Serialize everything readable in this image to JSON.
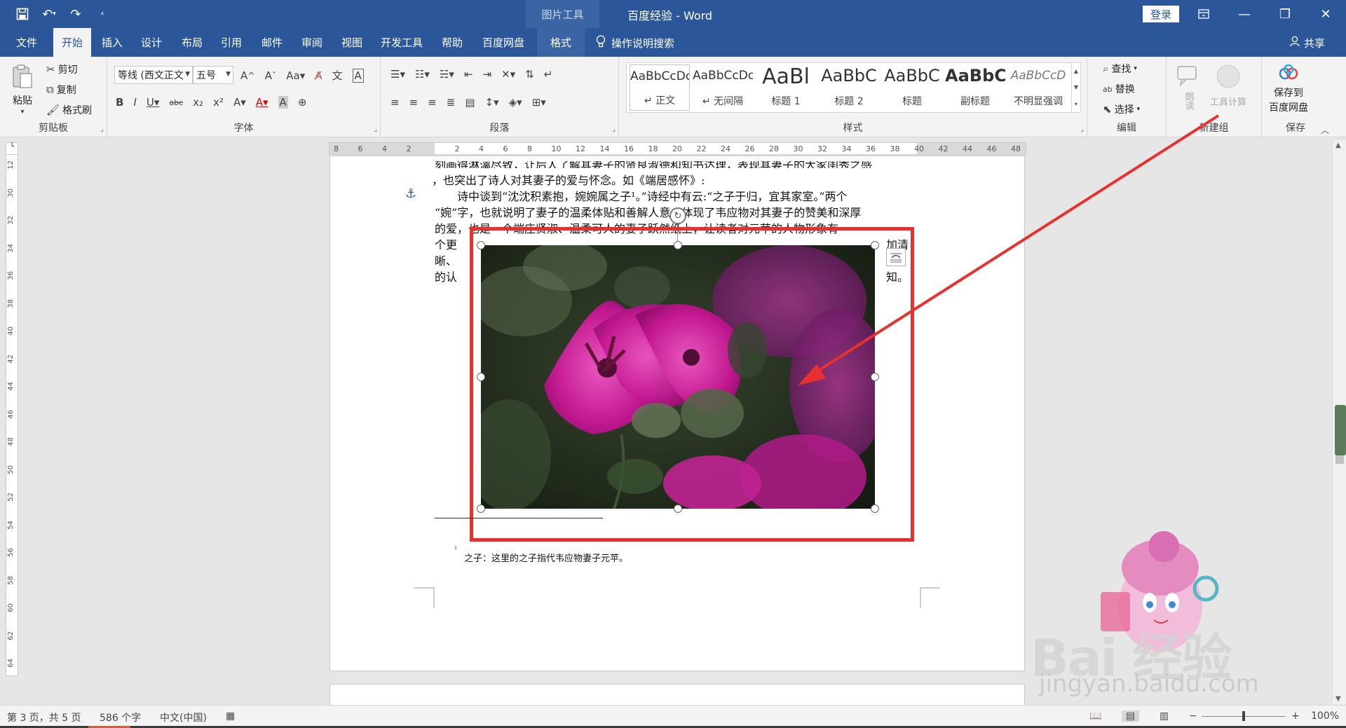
{
  "titlebar": {
    "context_tab": "图片工具",
    "title": "百度经验  -  Word",
    "signin": "登录"
  },
  "tabs": [
    {
      "label": "文件"
    },
    {
      "label": "开始"
    },
    {
      "label": "插入"
    },
    {
      "label": "设计"
    },
    {
      "label": "布局"
    },
    {
      "label": "引用"
    },
    {
      "label": "邮件"
    },
    {
      "label": "审阅"
    },
    {
      "label": "视图"
    },
    {
      "label": "开发工具"
    },
    {
      "label": "帮助"
    },
    {
      "label": "百度网盘"
    },
    {
      "label": "格式"
    }
  ],
  "tellme": "操作说明搜索",
  "share": "共享",
  "ribbon": {
    "clipboard": {
      "label": "剪贴板",
      "paste": "粘贴",
      "cut": "剪切",
      "copy": "复制",
      "format_painter": "格式刷"
    },
    "font": {
      "label": "字体",
      "font_name": "等线 (西文正文",
      "font_size": "五号"
    },
    "paragraph": {
      "label": "段落"
    },
    "styles": {
      "label": "样式",
      "items": [
        {
          "preview": "AaBbCcDc",
          "name": "↵ 正文"
        },
        {
          "preview": "AaBbCcDc",
          "name": "↵ 无间隔"
        },
        {
          "preview": "AaBl",
          "name": "标题 1"
        },
        {
          "preview": "AaBbC",
          "name": "标题 2"
        },
        {
          "preview": "AaBbC",
          "name": "标题"
        },
        {
          "preview": "AaBbC",
          "name": "副标题"
        },
        {
          "preview": "AaBbCcD",
          "name": "不明显强调"
        }
      ]
    },
    "editing": {
      "label": "编辑",
      "find": "查找",
      "replace": "替换",
      "select": "选择"
    },
    "newgroup": {
      "label": "新建组",
      "read": "朗读",
      "tools": "工具计算"
    },
    "save": {
      "label": "保存",
      "save_to": "保存到",
      "baidu": "百度网盘"
    }
  },
  "ruler_h": [
    "8",
    "6",
    "4",
    "2",
    "",
    "2",
    "4",
    "6",
    "8",
    "10",
    "12",
    "14",
    "16",
    "18",
    "20",
    "22",
    "24",
    "26",
    "28",
    "30",
    "32",
    "34",
    "36",
    "38",
    "40",
    "42",
    "44",
    "46",
    "48"
  ],
  "ruler_v": [
    "12",
    "30",
    "32",
    "34",
    "36",
    "38",
    "40",
    "42",
    "44",
    "46",
    "48",
    "50",
    "52",
    "54",
    "56",
    "58",
    "60",
    "62",
    "64"
  ],
  "document": {
    "line0": "刻画得淋漓尽致，让后人了解其妻子的贤良淑德和知书达理，表现其妻子的大家闺秀之感",
    "line1": "，也突出了诗人对其妻子的爱与怀念。如《端居感怀》:",
    "line2": "诗中谈到“沈沈积素抱，婉婉属之子¹。”诗经中有云:“之子于归，宜其家室。”两个",
    "line3": "“婉”字，也就说明了妻子的温柔体贴和善解人意，体现了韦应物对其妻子的赞美和深厚",
    "line4": "的爱，也是一个端庄贤淑、温柔可人的妻子跃然纸上，让读者对元苹的人物形象有一",
    "wrap_left": [
      "个更",
      "晰、",
      "的认"
    ],
    "wrap_right": [
      "加清",
      "",
      "知。"
    ],
    "footnote_mark": "¹",
    "footnote": "之子：这里的之子指代韦应物妻子元苹。"
  },
  "statusbar": {
    "page": "第 3 页，共 5 页",
    "words": "586 个字",
    "lang": "中文(中国)",
    "zoom": "100%"
  },
  "watermark": {
    "brand": "Bai 经验",
    "url": "jingyan.baidu.com"
  },
  "colors": {
    "word_blue": "#2b579a",
    "annotation_red": "#e8312f"
  }
}
